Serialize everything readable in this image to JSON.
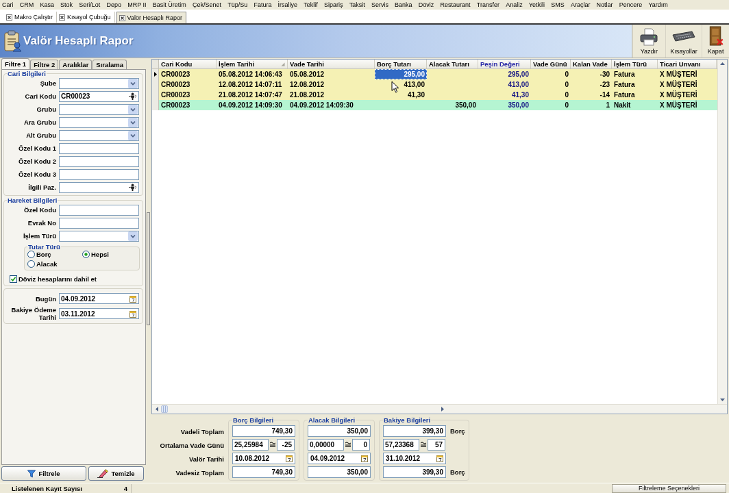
{
  "menu_bar": [
    "Cari",
    "CRM",
    "Kasa",
    "Stok",
    "Seri/Lot",
    "Depo",
    "MRP II",
    "Basit Üretim",
    "Çek/Senet",
    "Tüp/Su",
    "Fatura",
    "İrsaliye",
    "Teklif",
    "Sipariş",
    "Taksit",
    "Servis",
    "Banka",
    "Döviz",
    "Restaurant",
    "Transfer",
    "Analiz",
    "Yetkili",
    "SMS",
    "Araçlar",
    "Notlar",
    "Pencere",
    "Yardım"
  ],
  "document_tabs": [
    {
      "label": "Makro Çalıştır",
      "selected": false
    },
    {
      "label": "Kısayol Çubuğu",
      "selected": false
    },
    {
      "label": "Valör Hesaplı Rapor",
      "selected": true
    }
  ],
  "header": {
    "title": "Valör Hesaplı Rapor",
    "toolbar": [
      {
        "kind": "print",
        "label": "Yazdır"
      },
      {
        "kind": "shortcuts",
        "label": "Kısayollar"
      },
      {
        "kind": "close",
        "label": "Kapat"
      }
    ]
  },
  "filter_panel": {
    "tabs": [
      {
        "label": "Filtre 1",
        "selected": true
      },
      {
        "label": "Filtre 2",
        "selected": false
      },
      {
        "label": "Aralıklar",
        "selected": false
      },
      {
        "label": "Sıralama",
        "selected": false
      }
    ],
    "groups": [
      {
        "title": "Cari Bilgileri",
        "fields": [
          {
            "label": "Şube",
            "kind": "dropdown"
          },
          {
            "label": "Cari Kodu",
            "kind": "lookup",
            "value": "CR00023"
          },
          {
            "label": "Grubu",
            "kind": "dropdown"
          },
          {
            "label": "Ara Grubu",
            "kind": "dropdown"
          },
          {
            "label": "Alt Grubu",
            "kind": "dropdown"
          },
          {
            "label": "Özel Kodu 1",
            "kind": "text"
          },
          {
            "label": "Özel Kodu 2",
            "kind": "text"
          },
          {
            "label": "Özel Kodu 3",
            "kind": "text"
          },
          {
            "label": "İlgili Paz.",
            "kind": "lookup"
          }
        ]
      },
      {
        "title": "Hareket Bilgileri",
        "fields": [
          {
            "label": "Özel Kodu",
            "kind": "text"
          },
          {
            "label": "Evrak No",
            "kind": "text"
          },
          {
            "label": "İşlem Türü",
            "kind": "dropdown"
          }
        ],
        "amount_type": {
          "title": "Tutar Türü",
          "options": [
            {
              "label": "Borç",
              "selected": false
            },
            {
              "label": "Hepsi",
              "selected": true
            },
            {
              "label": "Alacak",
              "selected": false
            }
          ]
        },
        "include_foreign_currency": {
          "label": "Döviz hesaplarını dahil et",
          "checked": true
        }
      }
    ],
    "dates": [
      {
        "label": "Bugün",
        "value": "04.09.2012"
      },
      {
        "label": "Bakiye Ödeme Tarihi",
        "value": "03.11.2012"
      }
    ],
    "buttons": [
      {
        "kind": "filter",
        "label": "Filtrele"
      },
      {
        "kind": "clear",
        "label": "Temizle"
      }
    ]
  },
  "table": {
    "columns": [
      {
        "label": "Cari Kodu",
        "kind": "text",
        "sorted": false,
        "accent": false,
        "focused": false
      },
      {
        "label": "İşlem Tarihi",
        "kind": "date",
        "sorted": true,
        "accent": false,
        "focused": false
      },
      {
        "label": "Vade Tarihi",
        "kind": "date",
        "sorted": false,
        "accent": false,
        "focused": false
      },
      {
        "label": "Borç Tutarı",
        "kind": "amount",
        "sorted": false,
        "accent": false,
        "focused": true
      },
      {
        "label": "Alacak Tutarı",
        "kind": "amount",
        "sorted": false,
        "accent": false,
        "focused": false
      },
      {
        "label": "Peşin Değeri",
        "kind": "amount",
        "sorted": false,
        "accent": true,
        "focused": false
      },
      {
        "label": "Vade Günü",
        "kind": "number",
        "sorted": false,
        "accent": false,
        "focused": false
      },
      {
        "label": "Kalan Vade",
        "kind": "number",
        "sorted": false,
        "accent": false,
        "focused": false
      },
      {
        "label": "İşlem Türü",
        "kind": "text",
        "sorted": false,
        "accent": false,
        "focused": false
      },
      {
        "label": "Ticari Unvanı",
        "kind": "text",
        "sorted": false,
        "accent": false,
        "focused": false
      }
    ],
    "rows": [
      {
        "selected": true,
        "color": "#f5f1b4",
        "cells": [
          "CR00023",
          "05.08.2012 14:06:43",
          "05.08.2012",
          "295,00",
          null,
          "295,00",
          "0",
          "-30",
          "Fatura",
          "X MÜŞTERİ"
        ]
      },
      {
        "selected": false,
        "color": "#f5f1b4",
        "cells": [
          "CR00023",
          "12.08.2012 14:07:11",
          "12.08.2012",
          "413,00",
          null,
          "413,00",
          "0",
          "-23",
          "Fatura",
          "X MÜŞTERİ"
        ]
      },
      {
        "selected": false,
        "color": "#f5f1b4",
        "cells": [
          "CR00023",
          "21.08.2012 14:07:47",
          "21.08.2012",
          "41,30",
          null,
          "41,30",
          "0",
          "-14",
          "Fatura",
          "X MÜŞTERİ"
        ]
      },
      {
        "selected": false,
        "color": "#b5f5d2",
        "cells": [
          "CR00023",
          "04.09.2012 14:09:30",
          "04.09.2012 14:09:30",
          null,
          "350,00",
          "350,00",
          "0",
          "1",
          "Nakit",
          "X MÜŞTERİ"
        ]
      }
    ]
  },
  "summary": {
    "row_labels": [
      "Vadeli Toplam",
      "Ortalama Vade Günü",
      "Valör Tarihi",
      "Vadesiz Toplam"
    ],
    "groups": [
      {
        "title": "Borç Bilgileri",
        "term_total": "749,30",
        "average_term_days": "25,25984",
        "average_term_days_rounded": "-25",
        "value_date": "10.08.2012",
        "non_term_total": "749,30"
      },
      {
        "title": "Alacak Bilgileri",
        "term_total": "350,00",
        "average_term_days": "0,00000",
        "average_term_days_rounded": "0",
        "value_date": "04.09.2012",
        "non_term_total": "350,00"
      },
      {
        "title": "Bakiye Bilgileri",
        "term_total": "399,30",
        "term_total_side": "Borç",
        "average_term_days": "57,23368",
        "average_term_days_rounded": "57",
        "value_date": "31.10.2012",
        "non_term_total": "399,30",
        "non_term_total_side": "Borç"
      }
    ]
  },
  "status_bar": {
    "label": "Listelenen Kayıt Sayısı",
    "count": "4",
    "options_button": "Filtreleme Seçenekleri"
  }
}
